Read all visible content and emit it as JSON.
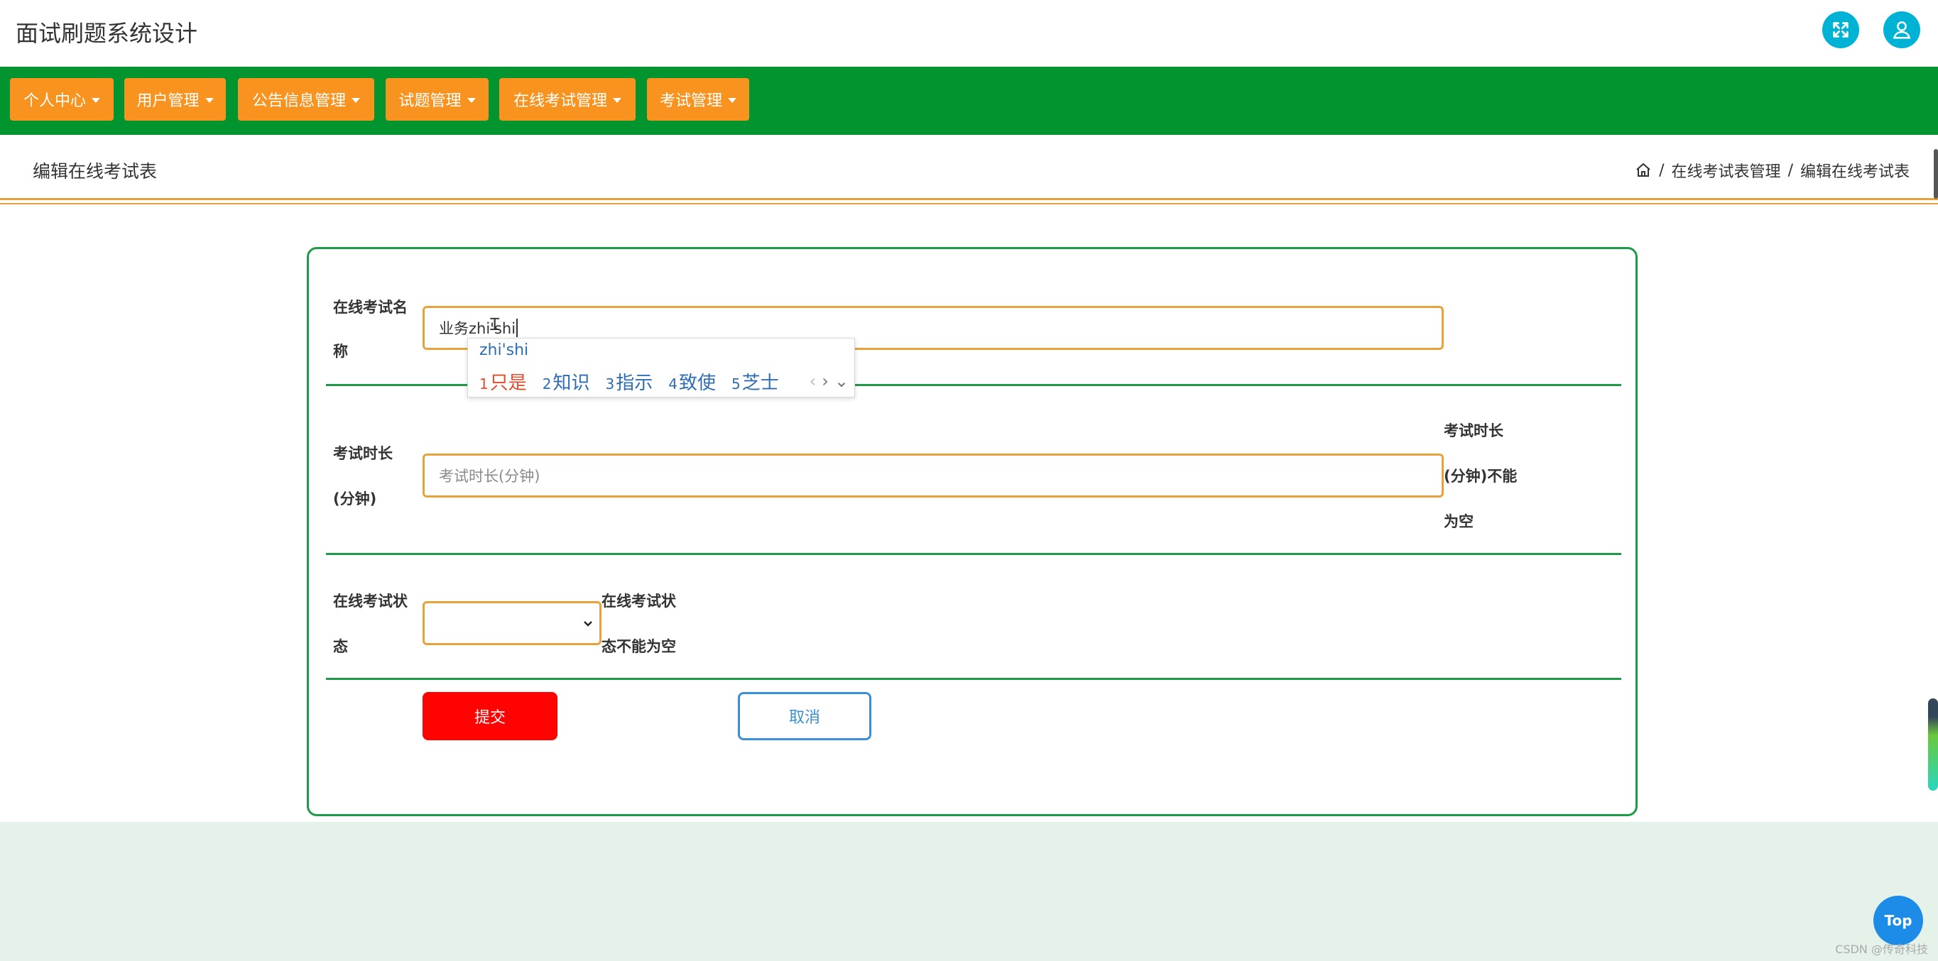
{
  "app": {
    "title": "面试刷题系统设计"
  },
  "header": {
    "fullscreen_icon": "expand-icon",
    "user_icon": "user-icon"
  },
  "nav": {
    "items": [
      {
        "label": "个人中心"
      },
      {
        "label": "用户管理"
      },
      {
        "label": "公告信息管理"
      },
      {
        "label": "试题管理"
      },
      {
        "label": "在线考试管理"
      },
      {
        "label": "考试管理"
      }
    ]
  },
  "page": {
    "title": "编辑在线考试表",
    "breadcrumb": {
      "sep": "/",
      "parent": "在线考试表管理",
      "current": "编辑在线考试表"
    }
  },
  "form": {
    "name_label_line1": "在线考试名",
    "name_label_line2": "称",
    "name_value": "业务zhi'shi",
    "duration_label_line1": "考试时长",
    "duration_label_line2": "(分钟)",
    "duration_placeholder": "考试时长(分钟)",
    "duration_error_line1": "考试时长",
    "duration_error_line2": "(分钟)不能",
    "duration_error_line3": "为空",
    "status_label_line1": "在线考试状",
    "status_label_line2": "态",
    "status_value": "",
    "status_error_line1": "在线考试状",
    "status_error_line2": "态不能为空",
    "submit_label": "提交",
    "cancel_label": "取消"
  },
  "ime": {
    "composition": "zhi'shi",
    "candidates": [
      {
        "num": "1",
        "text": "只是"
      },
      {
        "num": "2",
        "text": "知识"
      },
      {
        "num": "3",
        "text": "指示"
      },
      {
        "num": "4",
        "text": "致使"
      },
      {
        "num": "5",
        "text": "芝士"
      }
    ],
    "arrows": {
      "prev": "‹",
      "next": "›",
      "more": "⌄"
    }
  },
  "top_button": {
    "label": "Top"
  },
  "watermark": "CSDN @传奇科技",
  "colors": {
    "nav_bg": "#02952f",
    "nav_item": "#f8931f",
    "accent_border": "#e8a23c",
    "card_border": "#1f9a48",
    "submit": "#ff0303",
    "cancel": "#3b8fd4",
    "icon_btn": "#00b3d4"
  }
}
